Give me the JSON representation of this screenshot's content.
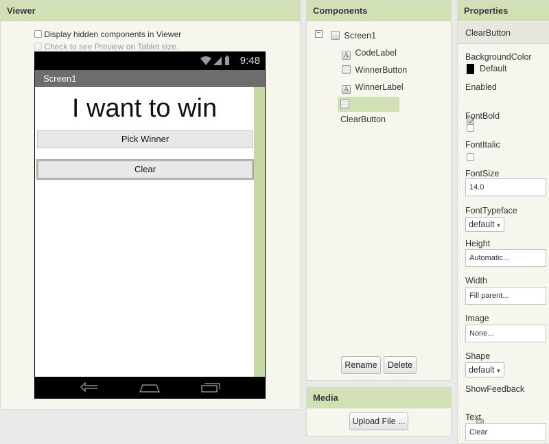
{
  "viewer": {
    "header": "Viewer",
    "option_hidden": "Display hidden components in Viewer",
    "option_tablet": "Check to see Preview on Tablet size.",
    "phone": {
      "clock": "9:48",
      "title": "Screen1",
      "code_label": "I want to win",
      "winner_button": "Pick Winner",
      "clear_button": "Clear"
    }
  },
  "components": {
    "header": "Components",
    "root": "Screen1",
    "items": [
      "CodeLabel",
      "WinnerButton",
      "WinnerLabel",
      "ClearButton"
    ],
    "selected": "ClearButton",
    "rename_label": "Rename",
    "delete_label": "Delete"
  },
  "media": {
    "header": "Media",
    "upload_label": "Upload File ..."
  },
  "properties": {
    "header": "Properties",
    "component": "ClearButton",
    "background_color": {
      "label": "BackgroundColor",
      "value": "Default",
      "swatch": "#000000"
    },
    "enabled": {
      "label": "Enabled",
      "checked": true
    },
    "font_bold": {
      "label": "FontBold",
      "checked": false
    },
    "font_italic": {
      "label": "FontItalic",
      "checked": false
    },
    "font_size": {
      "label": "FontSize",
      "value": "14.0"
    },
    "font_typeface": {
      "label": "FontTypeface",
      "value": "default"
    },
    "height": {
      "label": "Height",
      "value": "Automatic..."
    },
    "width": {
      "label": "Width",
      "value": "Fill parent..."
    },
    "image": {
      "label": "Image",
      "value": "None..."
    },
    "shape": {
      "label": "Shape",
      "value": "default"
    },
    "show_feedback": {
      "label": "ShowFeedback",
      "checked": true
    },
    "text": {
      "label": "Text",
      "value": "Clear"
    }
  },
  "colors": {
    "header_green": "#d2e0b6",
    "panel_bg": "#f6f6ef",
    "scroll_green": "#c7d9a2"
  }
}
